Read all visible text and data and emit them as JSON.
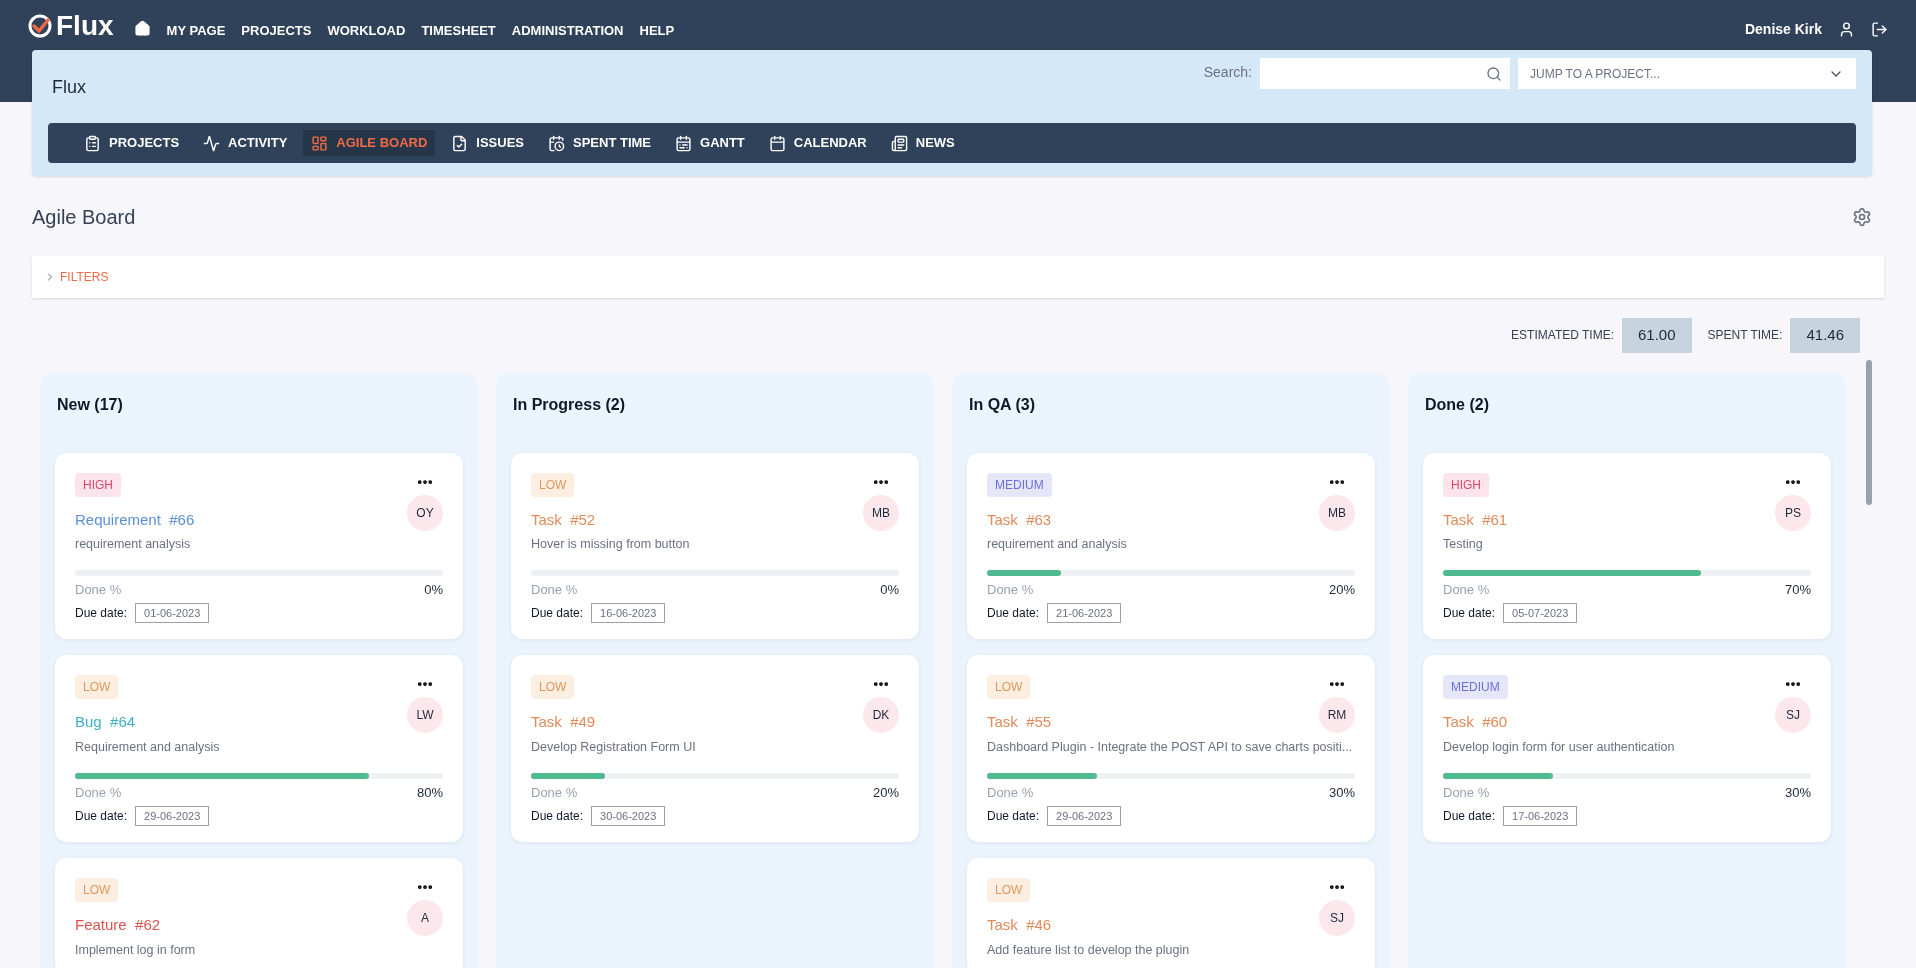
{
  "brand": {
    "name": "Flux"
  },
  "top_menu": [
    {
      "label": "MY PAGE"
    },
    {
      "label": "PROJECTS"
    },
    {
      "label": "WORKLOAD"
    },
    {
      "label": "TIMESHEET"
    },
    {
      "label": "ADMINISTRATION"
    },
    {
      "label": "HELP"
    }
  ],
  "user": {
    "name": "Denise Kirk"
  },
  "project": {
    "title": "Flux",
    "search_label": "Search:",
    "jump_placeholder": "JUMP TO A PROJECT..."
  },
  "project_tabs": [
    {
      "label": "PROJECTS",
      "selected": false
    },
    {
      "label": "ACTIVITY",
      "selected": false
    },
    {
      "label": "AGILE BOARD",
      "selected": true
    },
    {
      "label": "ISSUES",
      "selected": false
    },
    {
      "label": "SPENT TIME",
      "selected": false
    },
    {
      "label": "GANTT",
      "selected": false
    },
    {
      "label": "CALENDAR",
      "selected": false
    },
    {
      "label": "NEWS",
      "selected": false
    }
  ],
  "page_title": "Agile Board",
  "filters": {
    "label": "FILTERS",
    "expanded": false
  },
  "totals": [
    {
      "label": "ESTIMATED TIME:",
      "value": "61.00"
    },
    {
      "label": "SPENT TIME:",
      "value": "41.46"
    }
  ],
  "columns": [
    {
      "title": "New (17)",
      "cards": [
        {
          "priority": {
            "label": "HIGH",
            "kind": "high"
          },
          "tracker": "Requirement",
          "number": "#66",
          "color": "#5b8fd6",
          "assignee": "OY",
          "subject": "requirement analysis",
          "done_label": "Done %",
          "level": 0,
          "done": "0%",
          "due_label": "Due date:",
          "due": "01-06-2023"
        },
        {
          "priority": {
            "label": "LOW",
            "kind": "low"
          },
          "tracker": "Bug",
          "number": "#64",
          "color": "#3fb0c0",
          "assignee": "LW",
          "subject": "Requirement and analysis",
          "done_label": "Done %",
          "level": 0.8,
          "done": "80%",
          "due_label": "Due date:",
          "due": "29-06-2023"
        },
        {
          "priority": {
            "label": "LOW",
            "kind": "low"
          },
          "tracker": "Feature",
          "number": "#62",
          "color": "#d9534f",
          "assignee": "A",
          "subject": "Implement log in form"
        }
      ]
    },
    {
      "title": "In Progress (2)",
      "cards": [
        {
          "priority": {
            "label": "LOW",
            "kind": "low"
          },
          "tracker": "Task",
          "number": "#52",
          "color": "#e08a5a",
          "assignee": "MB",
          "subject": "Hover is missing from button",
          "done_label": "Done %",
          "level": 0,
          "done": "0%",
          "due_label": "Due date:",
          "due": "16-06-2023"
        },
        {
          "priority": {
            "label": "LOW",
            "kind": "low"
          },
          "tracker": "Task",
          "number": "#49",
          "color": "#e08a5a",
          "assignee": "DK",
          "subject": "Develop Registration Form UI",
          "done_label": "Done %",
          "level": 0.2,
          "done": "20%",
          "due_label": "Due date:",
          "due": "30-06-2023"
        }
      ]
    },
    {
      "title": "In QA (3)",
      "cards": [
        {
          "priority": {
            "label": "MEDIUM",
            "kind": "medium"
          },
          "tracker": "Task",
          "number": "#63",
          "color": "#e08a5a",
          "assignee": "MB",
          "subject": "requirement and analysis",
          "done_label": "Done %",
          "level": 0.2,
          "done": "20%",
          "due_label": "Due date:",
          "due": "21-06-2023"
        },
        {
          "priority": {
            "label": "LOW",
            "kind": "low"
          },
          "tracker": "Task",
          "number": "#55",
          "color": "#e08a5a",
          "assignee": "RM",
          "subject": "Dashboard Plugin - Integrate the POST API to save charts positi...",
          "done_label": "Done %",
          "level": 0.3,
          "done": "30%",
          "due_label": "Due date:",
          "due": "29-06-2023"
        },
        {
          "priority": {
            "label": "LOW",
            "kind": "low"
          },
          "tracker": "Task",
          "number": "#46",
          "color": "#e08a5a",
          "assignee": "SJ",
          "subject": "Add feature list to develop the plugin"
        }
      ]
    },
    {
      "title": "Done (2)",
      "cards": [
        {
          "priority": {
            "label": "HIGH",
            "kind": "high"
          },
          "tracker": "Task",
          "number": "#61",
          "color": "#e08a5a",
          "assignee": "PS",
          "subject": "Testing",
          "done_label": "Done %",
          "level": 0.7,
          "done": "70%",
          "due_label": "Due date:",
          "due": "05-07-2023"
        },
        {
          "priority": {
            "label": "MEDIUM",
            "kind": "medium"
          },
          "tracker": "Task",
          "number": "#60",
          "color": "#e08a5a",
          "assignee": "SJ",
          "subject": "Develop login form for user authentication",
          "done_label": "Done %",
          "level": 0.3,
          "done": "30%",
          "due_label": "Due date:",
          "due": "17-06-2023"
        }
      ]
    }
  ]
}
